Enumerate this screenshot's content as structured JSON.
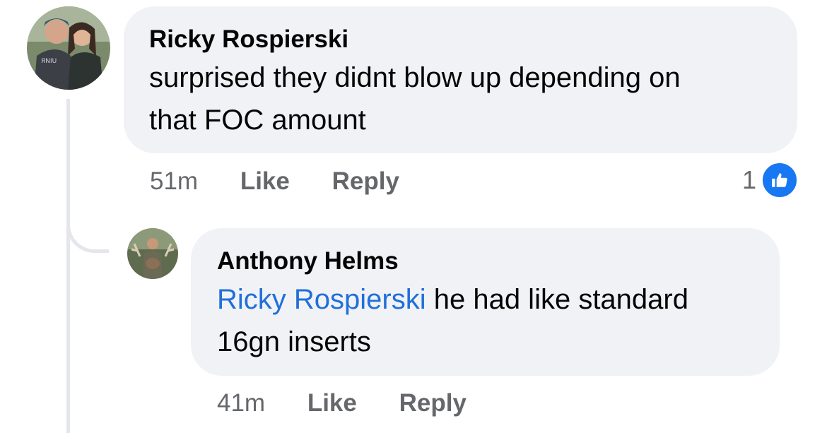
{
  "comments": [
    {
      "author": "Ricky Rospierski",
      "text_lines": [
        "surprised they didnt blow up depending on",
        "that FOC amount"
      ],
      "time": "51m",
      "like_label": "Like",
      "reply_label": "Reply",
      "reaction_count": "1",
      "reaction_icon": "thumbs-up-icon"
    },
    {
      "author": "Anthony Helms",
      "mention": "Ricky Rospierski",
      "text_after_mention": " he had like standard",
      "text_line2": "16gn inserts",
      "time": "41m",
      "like_label": "Like",
      "reply_label": "Reply"
    }
  ],
  "colors": {
    "bubble": "#f0f2f5",
    "mention": "#216fdb",
    "meta": "#65676b",
    "like_badge": "#1877f2"
  }
}
